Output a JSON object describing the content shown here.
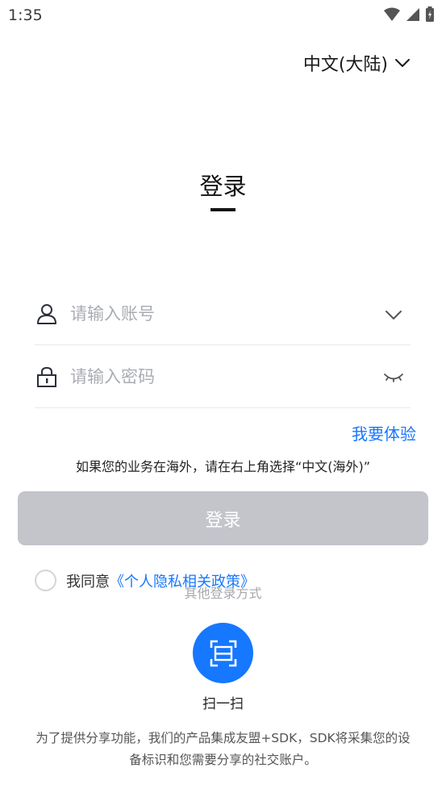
{
  "status_bar": {
    "time": "1:35"
  },
  "language": {
    "label": "中文(大陆)"
  },
  "title": "登录",
  "username": {
    "placeholder": "请输入账号"
  },
  "password": {
    "placeholder": "请输入密码"
  },
  "trial_link": "我要体验",
  "region_hint": "如果您的业务在海外，请在右上角选择“中文(海外)”",
  "login_button": "登录",
  "agreement": {
    "prefix": "我同意",
    "policy_link": "《个人隐私相关政策》"
  },
  "other_login_label": "其他登录方式",
  "scan": {
    "label": "扫一扫"
  },
  "sdk_notice": "为了提供分享功能，我们的产品集成友盟+SDK，SDK将采集您的设备标识和您需要分享的社交账户。",
  "colors": {
    "accent": "#1677ff",
    "button_disabled": "#c3c5cb"
  }
}
